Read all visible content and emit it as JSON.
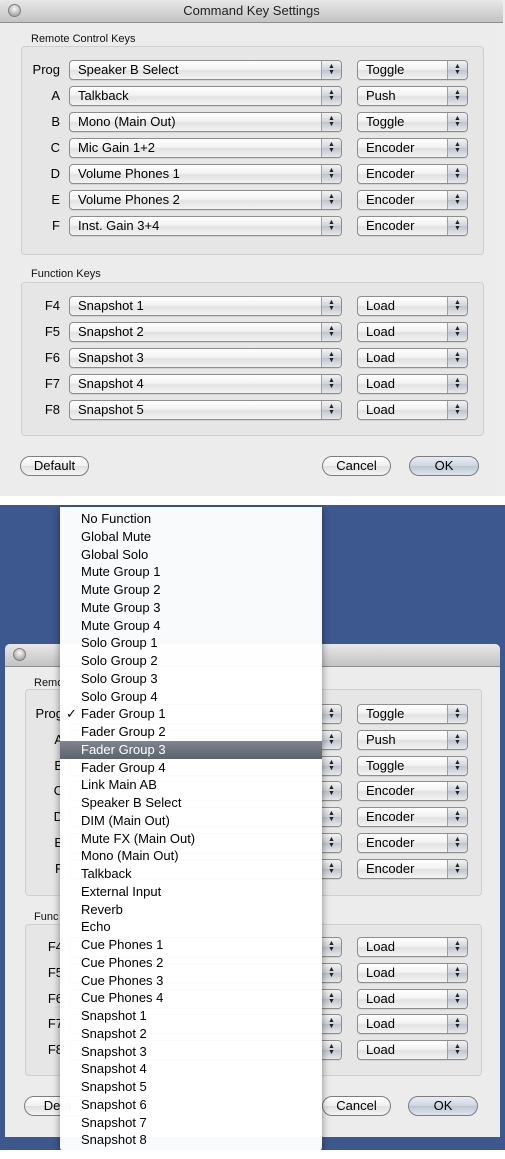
{
  "window": {
    "title": "Command Key Settings"
  },
  "remote": {
    "label": "Remote Control Keys",
    "rows": [
      {
        "key": "Prog",
        "function": "Speaker B Select",
        "mode": "Toggle"
      },
      {
        "key": "A",
        "function": "Talkback",
        "mode": "Push"
      },
      {
        "key": "B",
        "function": "Mono (Main Out)",
        "mode": "Toggle"
      },
      {
        "key": "C",
        "function": "Mic Gain 1+2",
        "mode": "Encoder"
      },
      {
        "key": "D",
        "function": "Volume Phones 1",
        "mode": "Encoder"
      },
      {
        "key": "E",
        "function": "Volume Phones 2",
        "mode": "Encoder"
      },
      {
        "key": "F",
        "function": "Inst. Gain 3+4",
        "mode": "Encoder"
      }
    ]
  },
  "function_keys": {
    "label": "Function Keys",
    "rows": [
      {
        "key": "F4",
        "function": "Snapshot 1",
        "mode": "Load"
      },
      {
        "key": "F5",
        "function": "Snapshot 2",
        "mode": "Load"
      },
      {
        "key": "F6",
        "function": "Snapshot 3",
        "mode": "Load"
      },
      {
        "key": "F7",
        "function": "Snapshot 4",
        "mode": "Load"
      },
      {
        "key": "F8",
        "function": "Snapshot 5",
        "mode": "Load"
      }
    ]
  },
  "buttons": {
    "default": "Default",
    "cancel": "Cancel",
    "ok": "OK"
  },
  "stepper_glyph": "▲\n▼",
  "second_view": {
    "background_color": "#3d578f",
    "remote_label_partial": "Remo",
    "function_label_partial": "Func",
    "default_partial": "Defa",
    "remote_keys_partial": [
      "Prog",
      "A",
      "B",
      "C",
      "D",
      "E",
      "F"
    ],
    "function_keys_partial": [
      "F4",
      "F5",
      "F6",
      "F7",
      "F8"
    ],
    "modes": [
      "Toggle",
      "Push",
      "Toggle",
      "Encoder",
      "Encoder",
      "Encoder",
      "Encoder"
    ],
    "fk_modes": [
      "Load",
      "Load",
      "Load",
      "Load",
      "Load"
    ],
    "menu": {
      "checked_item": "Fader Group 1",
      "highlighted_item": "Fader Group 3",
      "check_glyph": "✓",
      "items": [
        "No Function",
        "Global Mute",
        "Global Solo",
        "Mute Group 1",
        "Mute Group 2",
        "Mute Group 3",
        "Mute Group 4",
        "Solo Group 1",
        "Solo Group 2",
        "Solo Group 3",
        "Solo Group 4",
        "Fader Group 1",
        "Fader Group 2",
        "Fader Group 3",
        "Fader Group 4",
        "Link Main AB",
        "Speaker B Select",
        "DIM (Main Out)",
        "Mute FX (Main Out)",
        "Mono (Main Out)",
        "Talkback",
        "External Input",
        "Reverb",
        "Echo",
        "Cue Phones 1",
        "Cue Phones 2",
        "Cue Phones 3",
        "Cue Phones 4",
        "Snapshot 1",
        "Snapshot 2",
        "Snapshot 3",
        "Snapshot 4",
        "Snapshot 5",
        "Snapshot 6",
        "Snapshot 7",
        "Snapshot 8"
      ]
    }
  }
}
